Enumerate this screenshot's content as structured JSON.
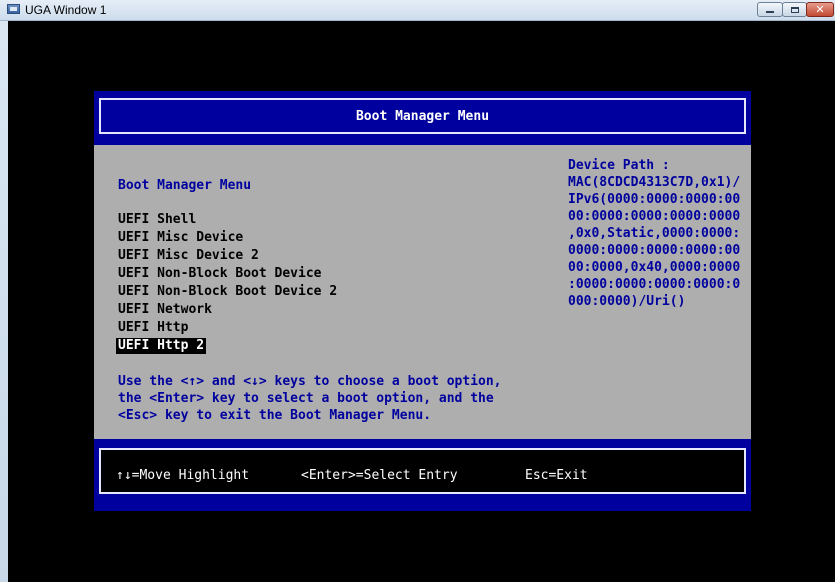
{
  "window": {
    "title": "UGA Window 1",
    "buttons": [
      "minimize",
      "maximize",
      "close"
    ]
  },
  "boot": {
    "header_title": "Boot Manager Menu",
    "section_title": "Boot Manager Menu",
    "items": [
      "UEFI Shell",
      "UEFI Misc Device",
      "UEFI Misc Device 2",
      "UEFI Non-Block Boot Device",
      "UEFI Non-Block Boot Device 2",
      "UEFI Network",
      "UEFI Http",
      "UEFI Http 2"
    ],
    "selected_index": 7,
    "help_lines": [
      "Use the <↑> and <↓> keys to choose a boot option,",
      "the <Enter> key to select a boot option, and the",
      "<Esc> key to exit the Boot Manager Menu."
    ],
    "device_path_lines": [
      "Device Path :",
      "MAC(8CDCD4313C7D,0x1)/",
      "IPv6(0000:0000:0000:00",
      "00:0000:0000:0000:0000",
      ",0x0,Static,0000:0000:",
      "0000:0000:0000:0000:00",
      "00:0000,0x40,0000:0000",
      ":0000:0000:0000:0000:0",
      "000:0000)/Uri()"
    ]
  },
  "footer": {
    "move": "↑↓=Move Highlight",
    "select": "<Enter>=Select Entry",
    "exit": "Esc=Exit"
  },
  "colors": {
    "firmware_blue": "#00009e",
    "body_gray": "#aeaeae",
    "background": "#000000"
  }
}
